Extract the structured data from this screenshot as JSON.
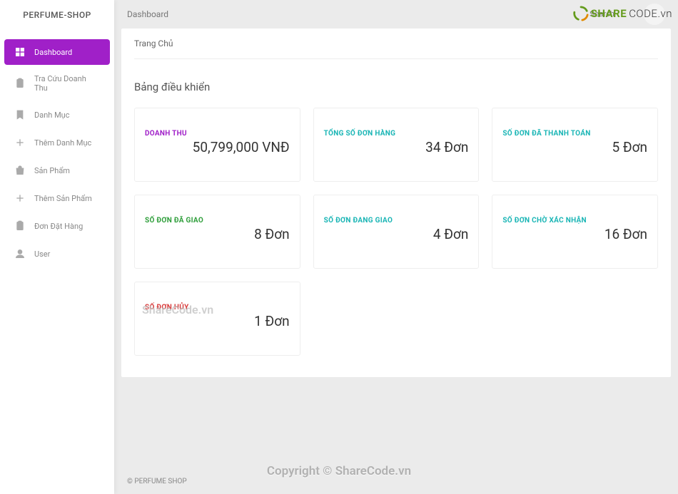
{
  "brand": "PERFUME-SHOP",
  "topbar": {
    "title": "Dashboard",
    "search_placeholder": "Search"
  },
  "sidebar": {
    "items": [
      {
        "label": "Dashboard"
      },
      {
        "label": "Tra Cứu Doanh Thu"
      },
      {
        "label": "Danh Mục"
      },
      {
        "label": "Thêm Danh Mục"
      },
      {
        "label": "Sản Phẩm"
      },
      {
        "label": "Thêm Sản Phẩm"
      },
      {
        "label": "Đơn Đặt Hàng"
      },
      {
        "label": "User"
      }
    ]
  },
  "breadcrumb": "Trang Chủ",
  "panel_title": "Bảng điều khiển",
  "cards": [
    {
      "label": "DOANH THU",
      "value": "50,799,000 VNĐ"
    },
    {
      "label": "TỔNG SỐ ĐƠN HÀNG",
      "value": "34 Đơn"
    },
    {
      "label": "SỐ ĐƠN ĐÃ THANH TOÁN",
      "value": "5 Đơn"
    },
    {
      "label": "SỐ ĐƠN ĐÃ GIAO",
      "value": "8 Đơn"
    },
    {
      "label": "SỐ ĐƠN ĐANG GIAO",
      "value": "4 Đơn"
    },
    {
      "label": "SỐ ĐƠN CHỜ XÁC NHẬN",
      "value": "16 Đơn"
    },
    {
      "label": "SỐ ĐƠN HỦY",
      "value": "1 Đơn"
    }
  ],
  "footer": "© PERFUME SHOP",
  "watermarks": {
    "main": "Copyright © ShareCode.vn",
    "center": "ShareCode.vn",
    "corner_a": "SHARE",
    "corner_b": "CODE.vn"
  }
}
